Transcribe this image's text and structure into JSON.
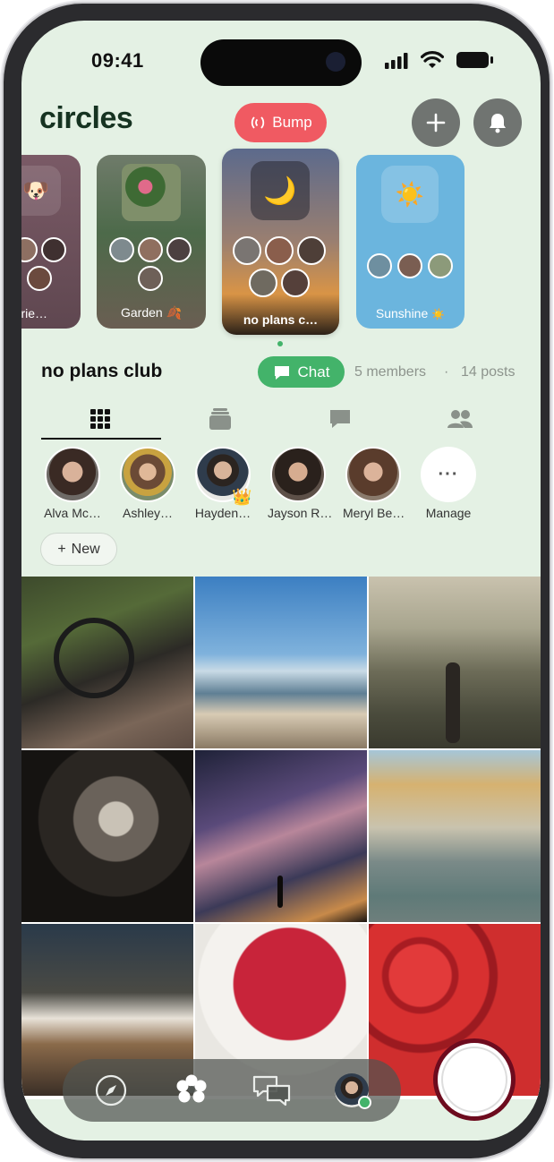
{
  "status_bar": {
    "time": "09:41"
  },
  "header": {
    "brand": "circles",
    "bump_label": "Bump",
    "add_icon": "plus-icon",
    "bell_icon": "bell-icon"
  },
  "circles": [
    {
      "label": "y Frie…",
      "icon": "🐶"
    },
    {
      "label": "Garden",
      "icon": "🍂"
    },
    {
      "label": "no plans c…",
      "icon": "🌙"
    },
    {
      "label": "Sunshine",
      "icon": "☀️"
    }
  ],
  "circle_info": {
    "name": "no plans club",
    "chat_label": "Chat",
    "members": "5 members",
    "separator": "·",
    "posts": "14 posts"
  },
  "tabs": [
    "grid",
    "stack",
    "chat",
    "people"
  ],
  "members": [
    {
      "name": "Alva Mc…"
    },
    {
      "name": "Ashley…"
    },
    {
      "name": "Hayden…",
      "badge": "👑"
    },
    {
      "name": "Jayson R…"
    },
    {
      "name": "Meryl Be…"
    },
    {
      "name": "Manage",
      "icon": "···"
    }
  ],
  "new_label": "New",
  "new_icon": "+",
  "photos": [
    "truck-interior",
    "beach-coast",
    "hiker-mountains",
    "husky-dog",
    "milky-way",
    "canal-town",
    "pour-over-coffee",
    "raspberries",
    "strawberries"
  ],
  "bottom_nav": {
    "items": [
      "compass-icon",
      "flower-icon",
      "chat-bubbles-icon",
      "profile-avatar"
    ]
  },
  "colors": {
    "accent_green": "#43b36a",
    "bump_red": "#f05a62",
    "background": "#e4f1e4",
    "shutter_ring": "#6d0b1e"
  }
}
